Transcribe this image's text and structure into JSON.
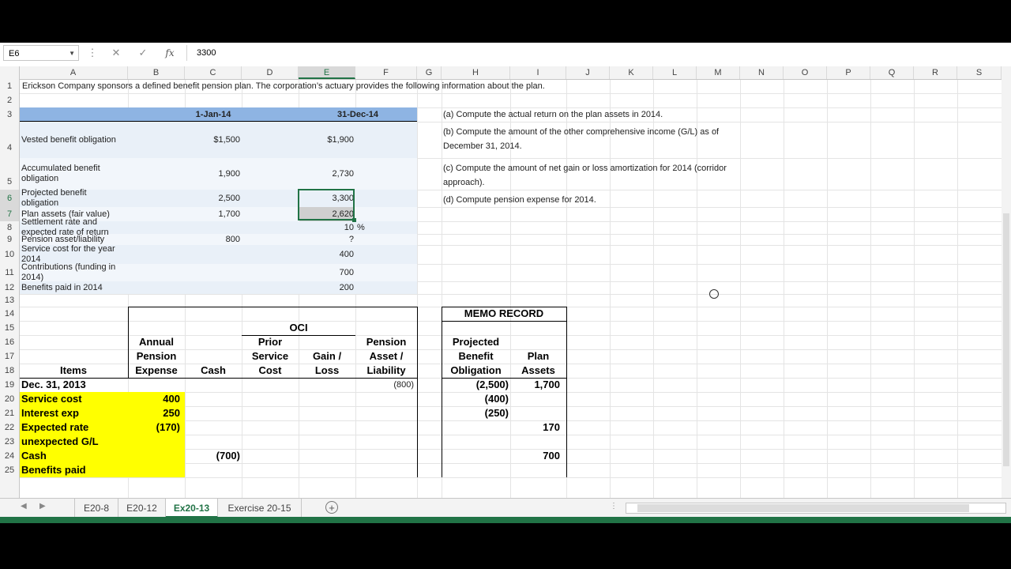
{
  "formula_bar": {
    "name_box": "E6",
    "formula": "3300",
    "fx_label": "fx"
  },
  "columns": [
    "A",
    "B",
    "C",
    "D",
    "E",
    "F",
    "G",
    "H",
    "I",
    "J",
    "K",
    "L",
    "M",
    "N",
    "O",
    "P",
    "Q",
    "R",
    "S"
  ],
  "rows": [
    "1",
    "2",
    "3",
    "4",
    "5",
    "6",
    "7",
    "8",
    "9",
    "10",
    "11",
    "12",
    "13",
    "14",
    "15",
    "16",
    "17",
    "18",
    "19",
    "20",
    "21",
    "22",
    "23",
    "24",
    "25"
  ],
  "title": "Erickson Company sponsors a defined benefit pension plan. The corporation’s actuary provides the following information about the plan.",
  "info_table": {
    "header_jan": "1-Jan-14",
    "header_dec": "31-Dec-14",
    "rows": [
      {
        "label": "Vested benefit obligation",
        "jan": "$1,500",
        "dec": "$1,900"
      },
      {
        "label": "Accumulated benefit obligation",
        "jan": "1,900",
        "dec": "2,730"
      },
      {
        "label": "Projected benefit obligation",
        "jan": "2,500",
        "dec": "3,300"
      },
      {
        "label": "Plan assets (fair value)",
        "jan": "1,700",
        "dec": "2,620"
      },
      {
        "label": "Settlement rate and expected rate of return",
        "jan": "",
        "dec": "10",
        "unit": "%"
      },
      {
        "label": "Pension asset/liability",
        "jan": "800",
        "dec": "?"
      },
      {
        "label": "Service cost for the year 2014",
        "jan": "",
        "dec": "400"
      },
      {
        "label": "Contributions (funding in 2014)",
        "jan": "",
        "dec": "700"
      },
      {
        "label": "Benefits paid in 2014",
        "jan": "",
        "dec": "200"
      }
    ]
  },
  "questions": [
    "(a) Compute the actual return on the plan assets in 2014.",
    "(b) Compute the amount of the other comprehensive income (G/L) as of December 31, 2014.",
    "(c) Compute the amount of net gain or loss amortization for 2014 (corridor approach).",
    "(d) Compute pension expense for 2014."
  ],
  "worksheet": {
    "h_items": "Items",
    "h_expense": [
      "Annual",
      "Pension",
      "Expense"
    ],
    "h_cash": "Cash",
    "h_oci": "OCI",
    "h_psc": [
      "Prior",
      "Service",
      "Cost"
    ],
    "h_gain": [
      "Gain /",
      "Loss"
    ],
    "h_pension": [
      "Pension",
      "Asset /",
      "Liability"
    ],
    "memo_title": "MEMO RECORD",
    "h_pbo": [
      "Projected",
      "Benefit",
      "Obligation"
    ],
    "h_plan": [
      "Plan",
      "Assets"
    ],
    "rows": [
      {
        "label": "Dec. 31, 2013",
        "expense": "",
        "cash": "",
        "pension": "(800)",
        "pbo": "(2,500)",
        "plan": "1,700"
      },
      {
        "label": "Service cost",
        "expense": "400",
        "cash": "",
        "pension": "",
        "pbo": "(400)",
        "plan": ""
      },
      {
        "label": "Interest exp",
        "expense": "250",
        "cash": "",
        "pension": "",
        "pbo": "(250)",
        "plan": ""
      },
      {
        "label": "Expected rate",
        "expense": "(170)",
        "cash": "",
        "pension": "",
        "pbo": "",
        "plan": "170"
      },
      {
        "label": "unexpected G/L",
        "expense": "",
        "cash": "",
        "pension": "",
        "pbo": "",
        "plan": ""
      },
      {
        "label": "Cash",
        "expense": "",
        "cash": "(700)",
        "pension": "",
        "pbo": "",
        "plan": "700"
      },
      {
        "label": "Benefits paid",
        "expense": "",
        "cash": "",
        "pension": "",
        "pbo": "",
        "plan": ""
      }
    ]
  },
  "sheet_tabs": [
    "E20-8",
    "E20-12",
    "Ex20-13",
    "Exercise 20-15"
  ],
  "active_tab": "Ex20-13",
  "add_sheet": "+",
  "colors": {
    "accent": "#217346",
    "header_blue": "#8eb4e3",
    "band_light": "#e9f0f8",
    "band_lighter": "#f2f6fb",
    "highlight": "#ffff00"
  }
}
